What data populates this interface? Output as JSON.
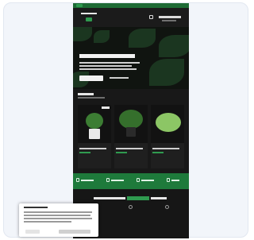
{
  "colors": {
    "accent": "#1e7a3b",
    "brand_green": "#2f9a4f",
    "page_background": "#161616",
    "frame_background": "#f2f5fa"
  },
  "icons": {
    "menu": "menu-icon",
    "search": "search-icon",
    "account": "account-icon",
    "cart": "cart-icon"
  },
  "nav": {},
  "hero": {},
  "products": {
    "items": [
      {
        "image": "potted-plant-white-pot"
      },
      {
        "image": "trailing-plant-dark-pot"
      },
      {
        "image": "round-leaf-plant"
      }
    ]
  },
  "benefits": {
    "count": 4
  },
  "cookie_banner": {
    "buttons": 2
  }
}
